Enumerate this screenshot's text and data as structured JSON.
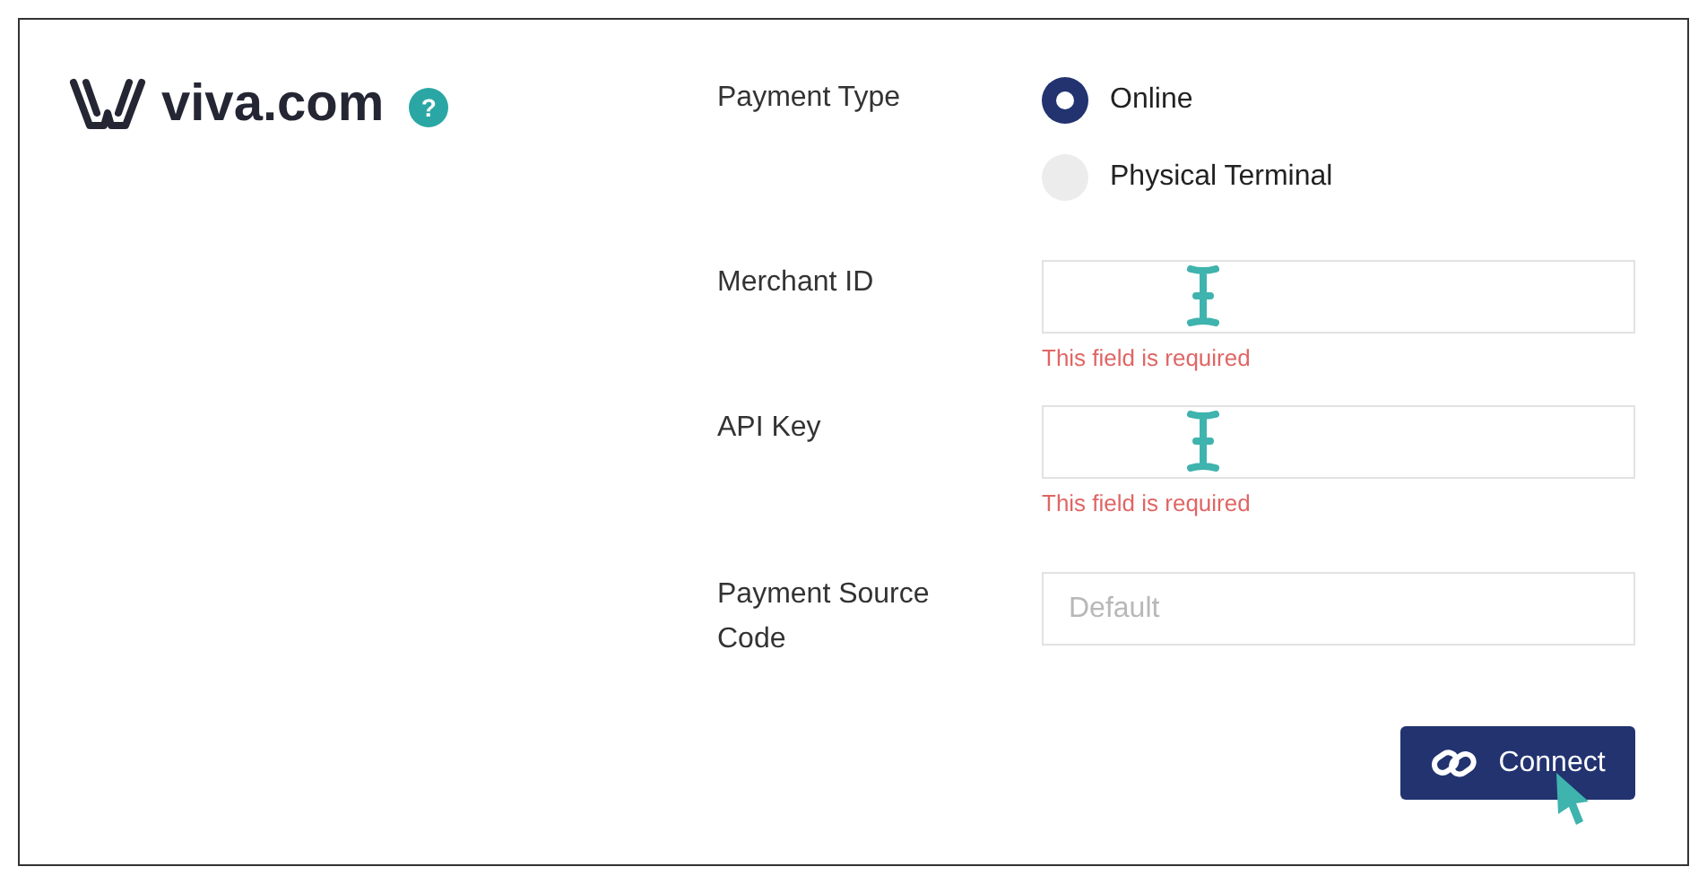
{
  "brand": {
    "logo_text": "viva.com",
    "help": "?"
  },
  "payment_type": {
    "label": "Payment Type",
    "options": [
      {
        "label": "Online",
        "selected": true
      },
      {
        "label": "Physical Terminal",
        "selected": false
      }
    ]
  },
  "fields": [
    {
      "label": "Merchant ID",
      "error": "This field is required",
      "cursor": true
    },
    {
      "label": "API Key",
      "error": "This field is required",
      "cursor": true
    },
    {
      "label": "Payment Source Code",
      "placeholder": "Default",
      "cursor": false
    }
  ],
  "connect_button": {
    "label": "Connect"
  }
}
